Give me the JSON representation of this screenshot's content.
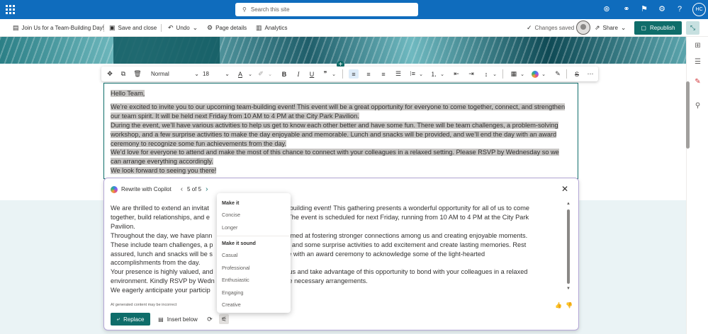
{
  "suite_bar": {
    "search_placeholder": "Search this site",
    "user_initials": "HC"
  },
  "command_bar": {
    "page_title": "Join Us for a Team-Building Day!",
    "save_close": "Save and close",
    "undo": "Undo",
    "page_details": "Page details",
    "analytics": "Analytics",
    "status": "Changes saved",
    "share": "Share",
    "republish": "Republish"
  },
  "format_toolbar": {
    "style": "Normal",
    "font_size": "18"
  },
  "editor": {
    "greeting": "Hello Team,",
    "paragraphs": [
      "We’re excited to invite you to our upcoming team-building event! This event will be a great opportunity for everyone to come together, connect, and strengthen our team spirit. It will be held next Friday from 10 AM to 4 PM at the City Park Pavilion.",
      "During the event, we’ll have various activities to help us get to know each other better and have some fun. There will be team challenges, a problem-solving workshop, and a few surprise activities to make the day enjoyable and memorable. Lunch and snacks will be provided, and we’ll end the day with an award ceremony to recognize some fun achievements from the day.",
      "We’d love for everyone to attend and make the most of this chance to connect with your colleagues in a relaxed setting. Please RSVP by Wednesday so we can arrange everything accordingly.",
      "We look forward to seeing you there!"
    ]
  },
  "copilot": {
    "title": "Rewrite with Copilot",
    "pager": "5 of 5",
    "lines": [
      "We are thrilled to extend an invitat",
      "am-building event! This gathering presents a wonderful opportunity for all of us to come",
      "together, build relationships, and e",
      "ion. The event is scheduled for next Friday, running from 10 AM to 4 PM at the City Park",
      "Pavilion.",
      "Throughout the day, we have plann",
      "s aimed at fostering stronger connections among us and creating enjoyable moments.",
      "These include team challenges, a p",
      "op, and some surprise activities to add excitement and create lasting memories. Rest",
      "assured, lunch and snacks will be s",
      "ude with an award ceremony to acknowledge some of the light-hearted",
      "accomplishments from the day.",
      "Your presence is highly valued, and",
      "n us and take advantage of this opportunity to bond with your colleagues in a relaxed",
      "environment. Kindly RSVP by Wedn",
      "the necessary arrangements.",
      "We eagerly anticipate your particip"
    ],
    "disclaimer": "AI generated content may be incorrect",
    "replace": "Replace",
    "insert_below": "Insert below"
  },
  "menu": {
    "heading_make_it": "Make it",
    "length_options": [
      "Concise",
      "Longer"
    ],
    "heading_sound": "Make it sound",
    "tone_options": [
      "Casual",
      "Professional",
      "Enthusiastic",
      "Engaging",
      "Creative"
    ]
  }
}
